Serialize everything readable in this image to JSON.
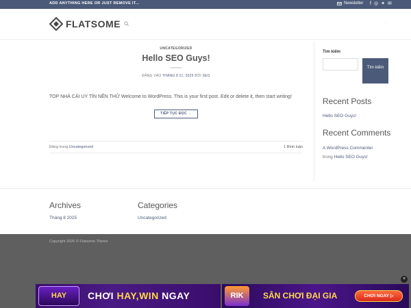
{
  "topbar": {
    "promo": "ADD ANYTHING HERE OR JUST REMOVE IT...",
    "newsletter": "Newsletter",
    "social_icons": [
      "facebook-icon",
      "instagram-icon",
      "twitter-icon",
      "email-icon"
    ]
  },
  "header": {
    "logo_text": "FLATSOME",
    "search_icon": "search-icon"
  },
  "post": {
    "category": "UNCATEGORIZED",
    "title": "Hello SEO Guys!",
    "meta_prefix": "ĐĂNG VÀO",
    "meta_date": "THÁNG 8 21, 2025",
    "meta_by": "BỞI",
    "meta_author": "SEO",
    "excerpt": "TOP NHÀ CÁI UY TÍN NÊN THỬ Welcome to WordPress. This is your first post. Edit or delete it, then start writing!",
    "read_more": "TIẾP TỤC ĐỌC →",
    "footer_prefix": "Đăng trong",
    "footer_category": "Uncategorized",
    "comment_count": "1 Bình luận"
  },
  "sidebar": {
    "search_label": "Tìm kiếm",
    "search_button": "Tìm kiếm",
    "recent_posts_title": "Recent Posts",
    "recent_post_1": "Hello SEO Guys!",
    "recent_comments_title": "Recent Comments",
    "comment_author": "A WordPress Commenter",
    "comment_on": "trong",
    "comment_post": "Hello SEO Guys!"
  },
  "widgets": {
    "archives_title": "Archives",
    "archives_item": "Tháng 8 2025",
    "categories_title": "Categories",
    "categories_item": "Uncategorized"
  },
  "footer": {
    "copyright": "Copyright 2026 © Flatsome Theme"
  },
  "ad": {
    "left_badge": "HAY",
    "left_text_a": "CHƠI ",
    "left_text_b": "HAY,WIN",
    "left_text_c": " NGAY",
    "right_badge": "RIK",
    "right_text": "SÂN CHƠI ĐẠI GIA",
    "right_cta": "CHƠI NGAY ▷"
  },
  "colors": {
    "primary": "#4b5a79",
    "footer_bg": "#5f5f5f"
  }
}
